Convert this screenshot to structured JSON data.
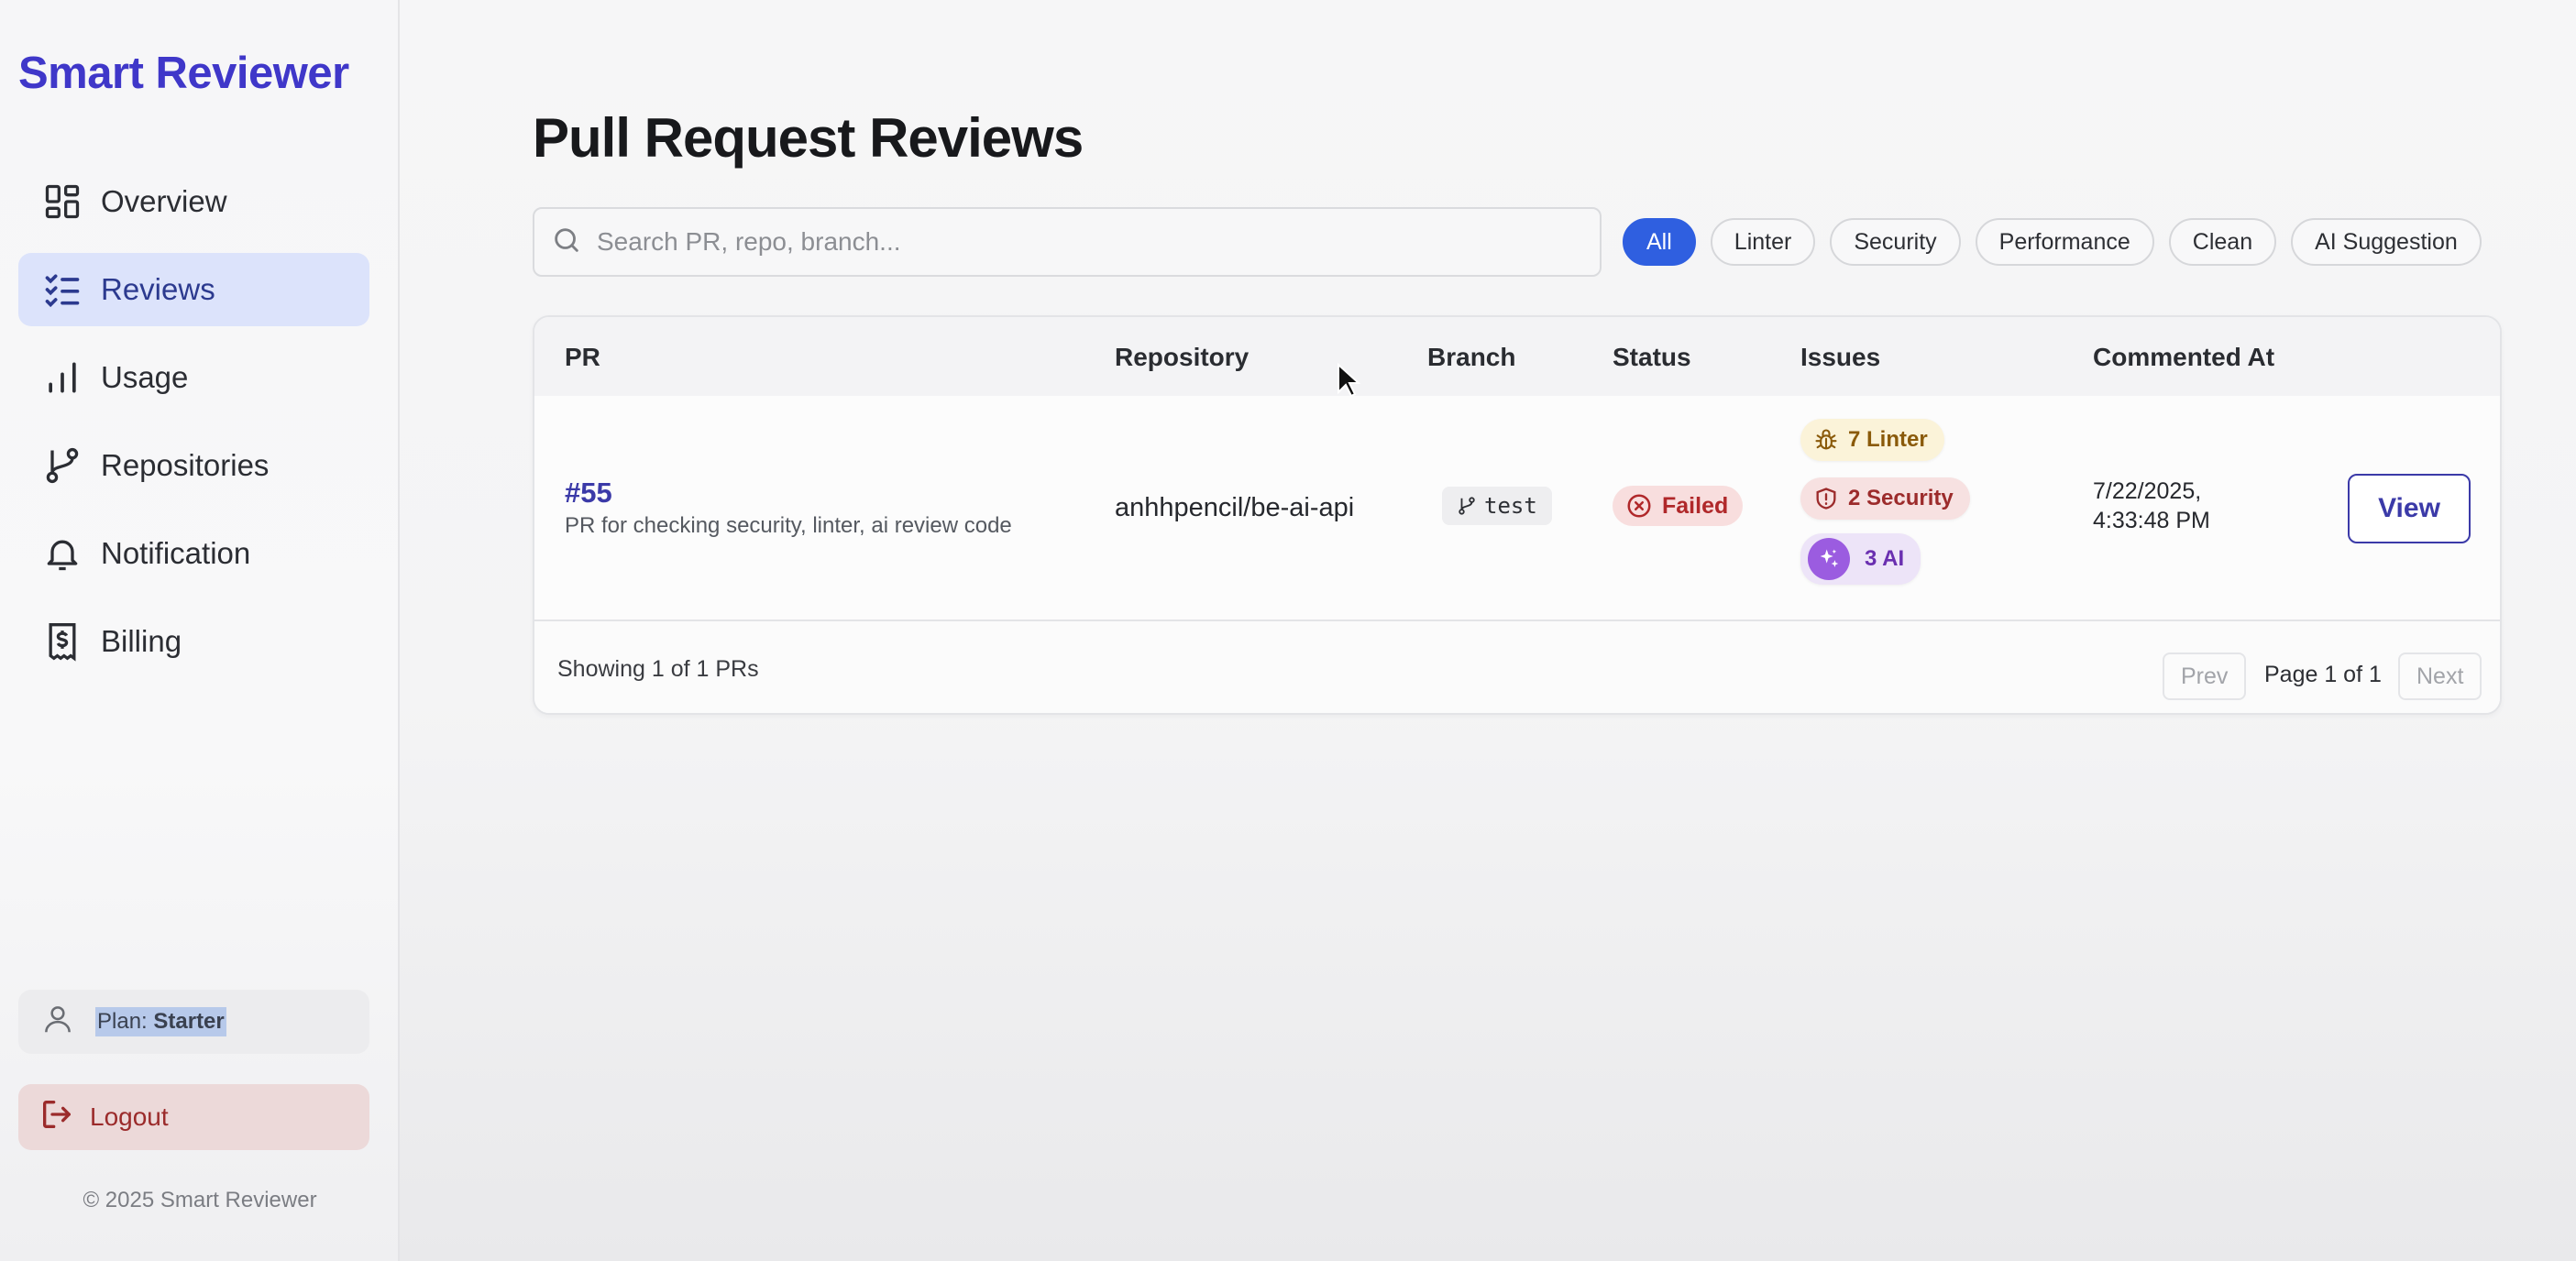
{
  "sidebar": {
    "brand": "Smart Reviewer",
    "nav": [
      {
        "label": "Overview",
        "icon": "grid-icon"
      },
      {
        "label": "Reviews",
        "icon": "checklist-icon"
      },
      {
        "label": "Usage",
        "icon": "bar-chart-icon"
      },
      {
        "label": "Repositories",
        "icon": "git-branch-icon"
      },
      {
        "label": "Notification",
        "icon": "bell-icon"
      },
      {
        "label": "Billing",
        "icon": "receipt-dollar-icon"
      }
    ],
    "active_item": "Reviews",
    "plan_label": "Plan:",
    "plan_value": "Starter",
    "logout_label": "Logout",
    "copyright": "© 2025 Smart Reviewer"
  },
  "main": {
    "title": "Pull Request Reviews",
    "search_placeholder": "Search PR, repo, branch...",
    "filters": [
      "All",
      "Linter",
      "Security",
      "Performance",
      "Clean",
      "AI Suggestion"
    ],
    "active_filter": "All",
    "table": {
      "columns": [
        "PR",
        "Repository",
        "Branch",
        "Status",
        "Issues",
        "Commented At"
      ],
      "rows": [
        {
          "pr_number": "#55",
          "pr_title": "PR for checking security, linter, ai review code",
          "repository": "anhhpencil/be-ai-api",
          "branch": "test",
          "status": "Failed",
          "issues": {
            "linter": "7 Linter",
            "security": "2 Security",
            "ai": "3 AI"
          },
          "commented_at_date": "7/22/2025,",
          "commented_at_time": "4:33:48 PM",
          "action": "View"
        }
      ]
    },
    "footer": {
      "showing": "Showing 1 of 1 PRs",
      "prev": "Prev",
      "page": "Page 1 of 1",
      "next": "Next"
    }
  },
  "colors": {
    "brand": "#3f37c9",
    "active_nav_bg": "#dce3fb",
    "active_chip": "#2f5fe0",
    "failed": "#b0282a",
    "view_button": "#3b3aa8"
  }
}
